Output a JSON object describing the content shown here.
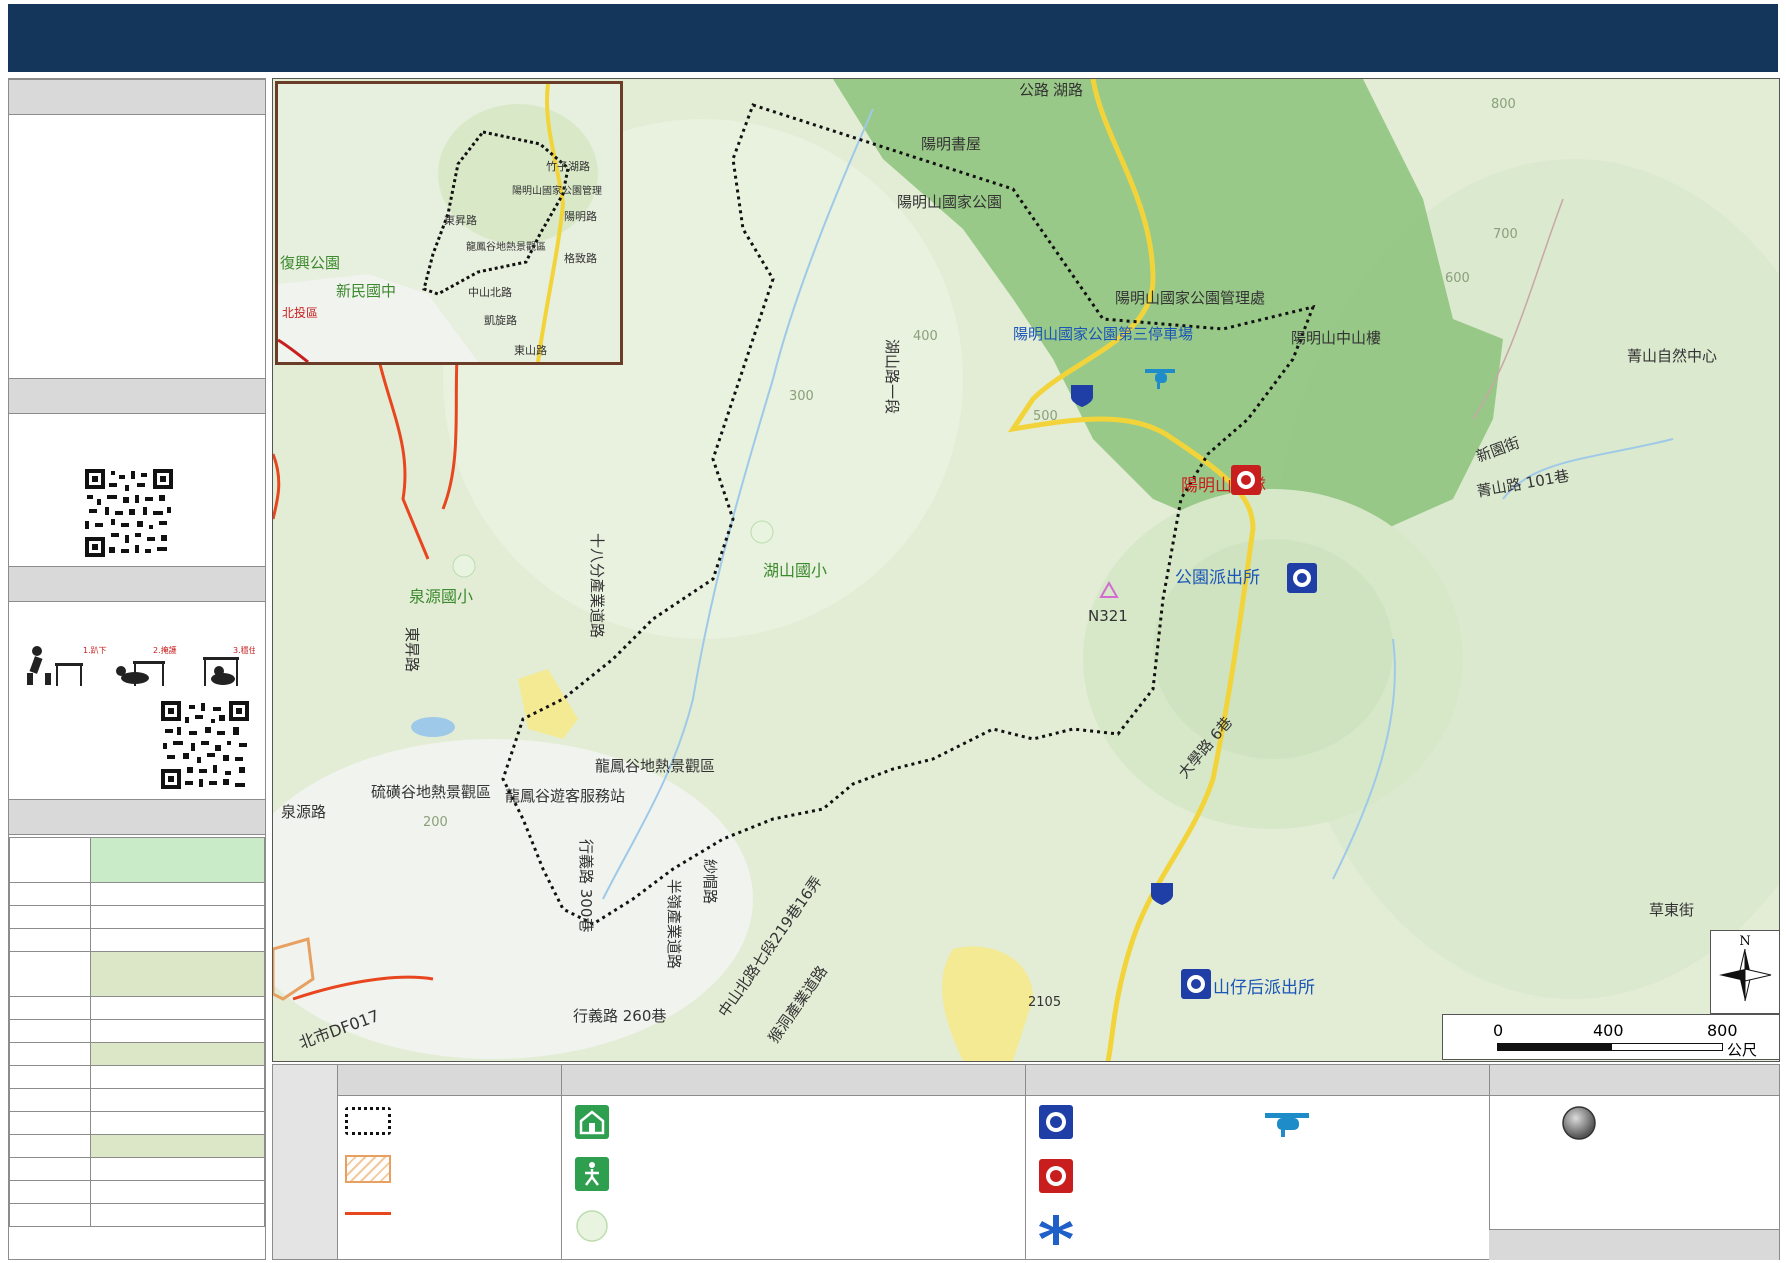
{
  "map": {
    "places": [
      {
        "id": "yangming-study",
        "text": "陽明書屋",
        "cls": ""
      },
      {
        "id": "yangmingshan-park",
        "text": "陽明山國家公園",
        "cls": ""
      },
      {
        "id": "park-hq",
        "text": "陽明山國家公園管理處",
        "cls": ""
      },
      {
        "id": "third-parking",
        "text": "陽明山國家公園第三停車場",
        "cls": "lbl-blue"
      },
      {
        "id": "zhongshan-hall",
        "text": "陽明山中山樓",
        "cls": ""
      },
      {
        "id": "fire-unit",
        "text": "陽明山分隊",
        "cls": "lbl-red"
      },
      {
        "id": "park-police",
        "text": "公園派出所",
        "cls": "lbl-blue"
      },
      {
        "id": "shanzaihou-police",
        "text": "山仔后派出所",
        "cls": "lbl-blue"
      },
      {
        "id": "qingshan-center",
        "text": "菁山自然中心",
        "cls": ""
      },
      {
        "id": "hushan-school",
        "text": "湖山國小",
        "cls": "lbl-green"
      },
      {
        "id": "quanyuan-school",
        "text": "泉源國小",
        "cls": "lbl-green"
      },
      {
        "id": "longfeng-valley",
        "text": "龍鳳谷地熱景觀區",
        "cls": ""
      },
      {
        "id": "sulfur-valley",
        "text": "硫磺谷地熱景觀區",
        "cls": ""
      },
      {
        "id": "longfeng-visitor",
        "text": "龍鳳谷遊客服務站",
        "cls": ""
      },
      {
        "id": "n321",
        "text": "N321",
        "cls": ""
      },
      {
        "id": "df017",
        "text": "北市DF017",
        "cls": ""
      },
      {
        "id": "hushan-rd1",
        "text": "湖山路一段",
        "cls": ""
      },
      {
        "id": "quanyuan-rd",
        "text": "泉源路",
        "cls": ""
      },
      {
        "id": "dongsheng-rd",
        "text": "東昇路",
        "cls": ""
      },
      {
        "id": "shibafen",
        "text": "十八分產業道路",
        "cls": ""
      },
      {
        "id": "xinyuan-st",
        "text": "新園街",
        "cls": ""
      },
      {
        "id": "qingshan101",
        "text": "菁山路 101巷",
        "cls": ""
      },
      {
        "id": "caodong-st",
        "text": "草東街",
        "cls": ""
      },
      {
        "id": "gongyuan-rd",
        "text": "公路",
        "cls": ""
      },
      {
        "id": "hu-rd",
        "text": "湖路",
        "cls": ""
      },
      {
        "id": "daxue-rd",
        "text": "大學路 6巷",
        "cls": ""
      },
      {
        "id": "zhongshan-n7",
        "text": "中山北路七段219巷16弄",
        "cls": ""
      },
      {
        "id": "houdong-rd",
        "text": "猴洞產業道路",
        "cls": ""
      },
      {
        "id": "xinglai-260",
        "text": "行義路 260巷",
        "cls": ""
      },
      {
        "id": "bandao",
        "text": "半嶺產業道路",
        "cls": ""
      },
      {
        "id": "shamao",
        "text": "紗帽路",
        "cls": ""
      },
      {
        "id": "c2105",
        "text": "2105",
        "cls": ""
      },
      {
        "id": "xinglai-300",
        "text": "行義路 300巷",
        "cls": ""
      }
    ],
    "contours": [
      "800",
      "700",
      "600",
      "500",
      "400",
      "300",
      "200"
    ]
  },
  "inset": {
    "labels": [
      {
        "id": "fuxing-park",
        "text": "復興公園",
        "cls": "lbl-green"
      },
      {
        "id": "xinmin-jh",
        "text": "新民國中",
        "cls": "lbl-green"
      },
      {
        "id": "beitou",
        "text": "北投區",
        "cls": "lbl-red"
      },
      {
        "id": "zhuzihu-rd",
        "text": "竹子湖路",
        "cls": ""
      },
      {
        "id": "park-mgmt",
        "text": "陽明山國家公園管理",
        "cls": ""
      },
      {
        "id": "yangming-rd",
        "text": "陽明路",
        "cls": ""
      },
      {
        "id": "dongsheng",
        "text": "東昇路",
        "cls": ""
      },
      {
        "id": "longfeng",
        "text": "龍鳳谷地熱景觀區",
        "cls": ""
      },
      {
        "id": "gezhi-rd",
        "text": "格致路",
        "cls": ""
      },
      {
        "id": "zhongshan-n",
        "text": "中山北路",
        "cls": ""
      },
      {
        "id": "kaixuan-rd",
        "text": "凱旋路",
        "cls": ""
      },
      {
        "id": "dongshan-rd",
        "text": "東山路",
        "cls": ""
      }
    ]
  },
  "scale": {
    "ticks": [
      "0",
      "400",
      "800"
    ],
    "unit": "公尺"
  },
  "north": {
    "label": "N"
  },
  "drill": {
    "steps": [
      "1.趴下",
      "2.掩護",
      "3.穩住"
    ]
  },
  "colors": {
    "header": "#14365a",
    "park": "#8cc27a",
    "boundary": "#111111",
    "fault": "#e8461e",
    "road": "#f2d43a"
  }
}
